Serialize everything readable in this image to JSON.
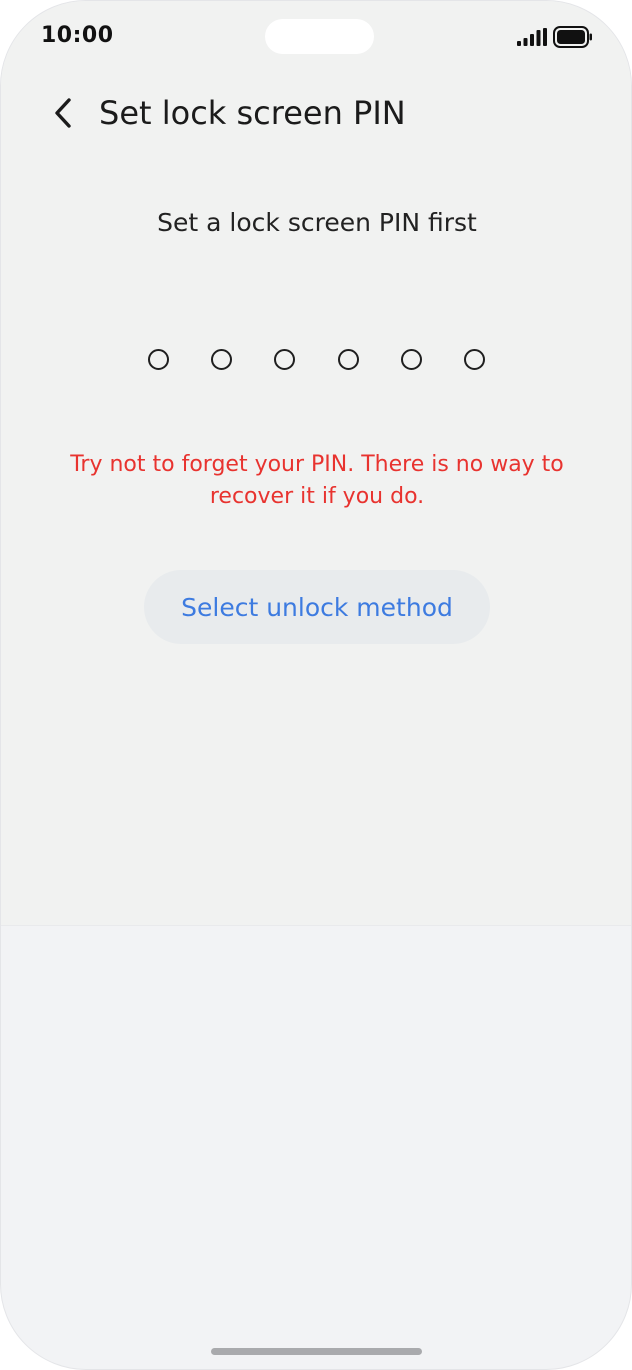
{
  "status_bar": {
    "time": "10:00",
    "signal_icon": "cellular-signal-icon",
    "battery_icon": "battery-full-icon"
  },
  "header": {
    "back_icon": "chevron-left-icon",
    "title": "Set lock screen PIN"
  },
  "main": {
    "prompt": "Set a lock screen PIN first",
    "pin_length": 6,
    "pin_entered": 0,
    "warning": "Try not to forget your PIN. There is no way to recover it if you do.",
    "unlock_method_label": "Select unlock method"
  },
  "colors": {
    "warning": "#e8332f",
    "accent": "#3d7be0",
    "background": "#f1f2f1"
  }
}
